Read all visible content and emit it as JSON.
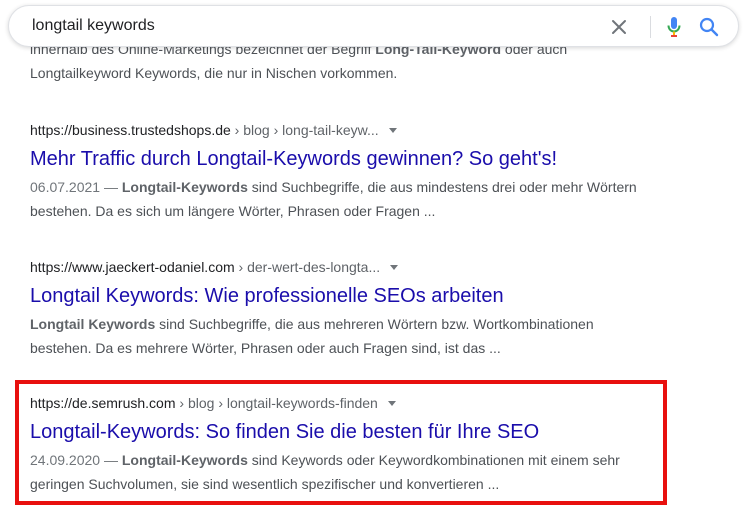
{
  "search": {
    "query": "longtail keywords"
  },
  "cut_snippet": {
    "line1_a": "innerhalb des Online-Marketings bezeichnet der Begriff ",
    "line1_b": "Long-Tail-Keyword",
    "line1_c": " oder auch",
    "line2": "Longtailkeyword Keywords, die nur in Nischen vorkommen."
  },
  "results": [
    {
      "domain": "https://business.trustedshops.de",
      "path": " › blog › long-tail-keyw...",
      "title": "Mehr Traffic durch Longtail-Keywords gewinnen? So geht's!",
      "date": "06.07.2021 — ",
      "bold": "Longtail-Keywords",
      "text": " sind Suchbegriffe, die aus mindestens drei oder mehr Wörtern bestehen. Da es sich um längere Wörter, Phrasen oder Fragen ..."
    },
    {
      "domain": "https://www.jaeckert-odaniel.com",
      "path": " › der-wert-des-longta...",
      "title": "Longtail Keywords: Wie professionelle SEOs arbeiten",
      "date": "",
      "bold": "Longtail Keywords",
      "text": " sind Suchbegriffe, die aus mehreren Wörtern bzw. Wortkombinationen bestehen. Da es mehrere Wörter, Phrasen oder auch Fragen sind, ist das ..."
    },
    {
      "domain": "https://de.semrush.com",
      "path": " › blog › longtail-keywords-finden",
      "title": "Longtail-Keywords: So finden Sie die besten für Ihre SEO",
      "date": "24.09.2020 — ",
      "bold": "Longtail-Keywords",
      "text": " sind Keywords oder Keywordkombinationen mit einem sehr geringen Suchvolumen, sie sind wesentlich spezifischer und konvertieren ..."
    }
  ],
  "icons": {
    "clear": "close-icon",
    "mic": "microphone-icon",
    "search": "search-icon"
  },
  "colors": {
    "link": "#1a0dab",
    "highlight": "#e8100e",
    "mic_blue": "#4285f4",
    "mic_red": "#ea4335"
  }
}
